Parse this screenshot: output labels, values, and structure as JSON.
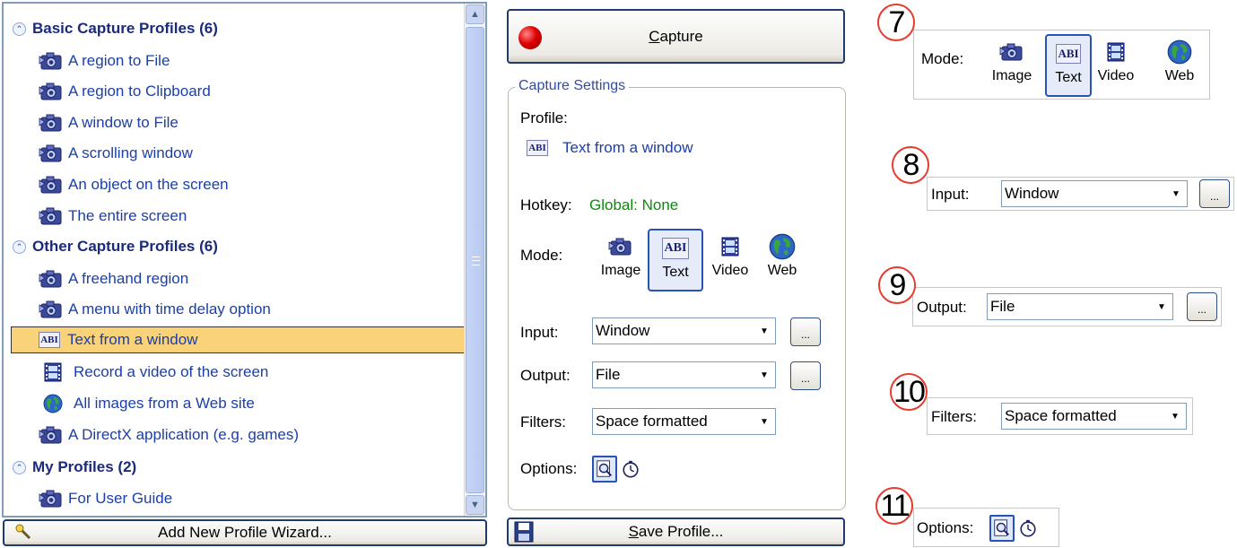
{
  "profile_list": {
    "groups": [
      {
        "title": "Basic Capture Profiles (6)",
        "items": [
          "A region to File",
          "A region to Clipboard",
          "A window to File",
          "A scrolling window",
          "An object on the screen",
          "The entire screen"
        ]
      },
      {
        "title": "Other Capture Profiles (6)",
        "items": [
          "A freehand region",
          "A menu with time delay option",
          "Text from a window",
          "Record a video of the screen",
          "All images from a Web site",
          "A DirectX application (e.g. games)"
        ]
      },
      {
        "title": "My Profiles (2)",
        "items": [
          "For User Guide"
        ]
      }
    ],
    "selected_item": "Text from a window"
  },
  "add_wizard_button": "Add New Profile Wizard...",
  "capture_button": {
    "label_underlined": "C",
    "label_rest": "apture"
  },
  "save_profile_button": {
    "label_underlined": "S",
    "label_rest": "ave Profile..."
  },
  "capture_settings": {
    "legend": "Capture Settings",
    "profile_label": "Profile:",
    "profile_value": "Text from a window",
    "hotkey_label": "Hotkey:",
    "hotkey_value": "Global: None",
    "mode_label": "Mode:",
    "modes": [
      "Image",
      "Text",
      "Video",
      "Web"
    ],
    "active_mode": "Text",
    "input_label": "Input:",
    "input_value": "Window",
    "output_label": "Output:",
    "output_value": "File",
    "filters_label": "Filters:",
    "filters_value": "Space formatted",
    "options_label": "Options:",
    "dots": "..."
  },
  "callouts": [
    {
      "number": "7",
      "label": "Mode:"
    },
    {
      "number": "8",
      "label": "Input:",
      "value": "Window"
    },
    {
      "number": "9",
      "label": "Output:",
      "value": "File"
    },
    {
      "number": "10",
      "label": "Filters:",
      "value": "Space formatted"
    },
    {
      "number": "11",
      "label": "Options:"
    }
  ],
  "colors": {
    "selection": "#f9d279",
    "link_blue": "#1b3fa8",
    "hotkey_green": "#0b8a0b",
    "badge_red": "#e63c2f"
  },
  "icons": [
    "camera-icon",
    "text-abi-icon",
    "film-icon",
    "globe-icon",
    "record-icon",
    "floppy-icon",
    "wand-icon",
    "magnifier-icon",
    "timer-icon"
  ]
}
